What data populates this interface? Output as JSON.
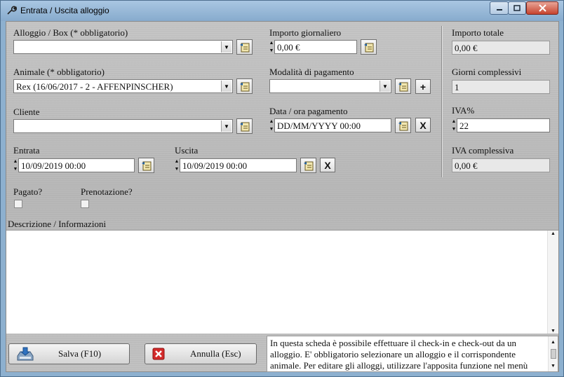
{
  "window": {
    "title": "Entrata / Uscita alloggio"
  },
  "form": {
    "alloggio": {
      "label": "Alloggio / Box (* obbligatorio)",
      "value": ""
    },
    "animale": {
      "label": "Animale (* obbligatorio)",
      "value": "Rex (16/06/2017 - 2 - AFFENPINSCHER)"
    },
    "cliente": {
      "label": "Cliente",
      "value": ""
    },
    "importo_giornaliero": {
      "label": "Importo giornaliero",
      "value": "0,00 €"
    },
    "modalita_pagamento": {
      "label": "Modalità di pagamento",
      "value": ""
    },
    "data_pagamento": {
      "label": "Data / ora pagamento",
      "value": "DD/MM/YYYY 00:00"
    },
    "entrata": {
      "label": "Entrata",
      "value": "10/09/2019 00:00"
    },
    "uscita": {
      "label": "Uscita",
      "value": "10/09/2019 00:00"
    },
    "pagato": {
      "label": "Pagato?",
      "checked": false
    },
    "prenotazione": {
      "label": "Prenotazione?",
      "checked": false
    },
    "add_label": "+",
    "clear_label": "X"
  },
  "totals": {
    "importo_totale": {
      "label": "Importo totale",
      "value": "0,00 €"
    },
    "giorni": {
      "label": "Giorni complessivi",
      "value": "1"
    },
    "iva": {
      "label": "IVA%",
      "value": "22"
    },
    "iva_complessiva": {
      "label": "IVA complessiva",
      "value": "0,00 €"
    }
  },
  "description": {
    "label": "Descrizione / Informazioni",
    "value": ""
  },
  "buttons": {
    "save": "Salva (F10)",
    "cancel": "Annulla (Esc)"
  },
  "help_text": "In questa scheda è possibile effettuare il check-in e check-out da un alloggio. E' obbligatorio selezionare un alloggio e il corrispondente animale. Per editare gli alloggi, utilizzare l'apposita funzione nel menù",
  "colors": {
    "titlebar": "#9dbcd9",
    "close_button": "#c7442f",
    "panel": "#bdbdbd"
  }
}
